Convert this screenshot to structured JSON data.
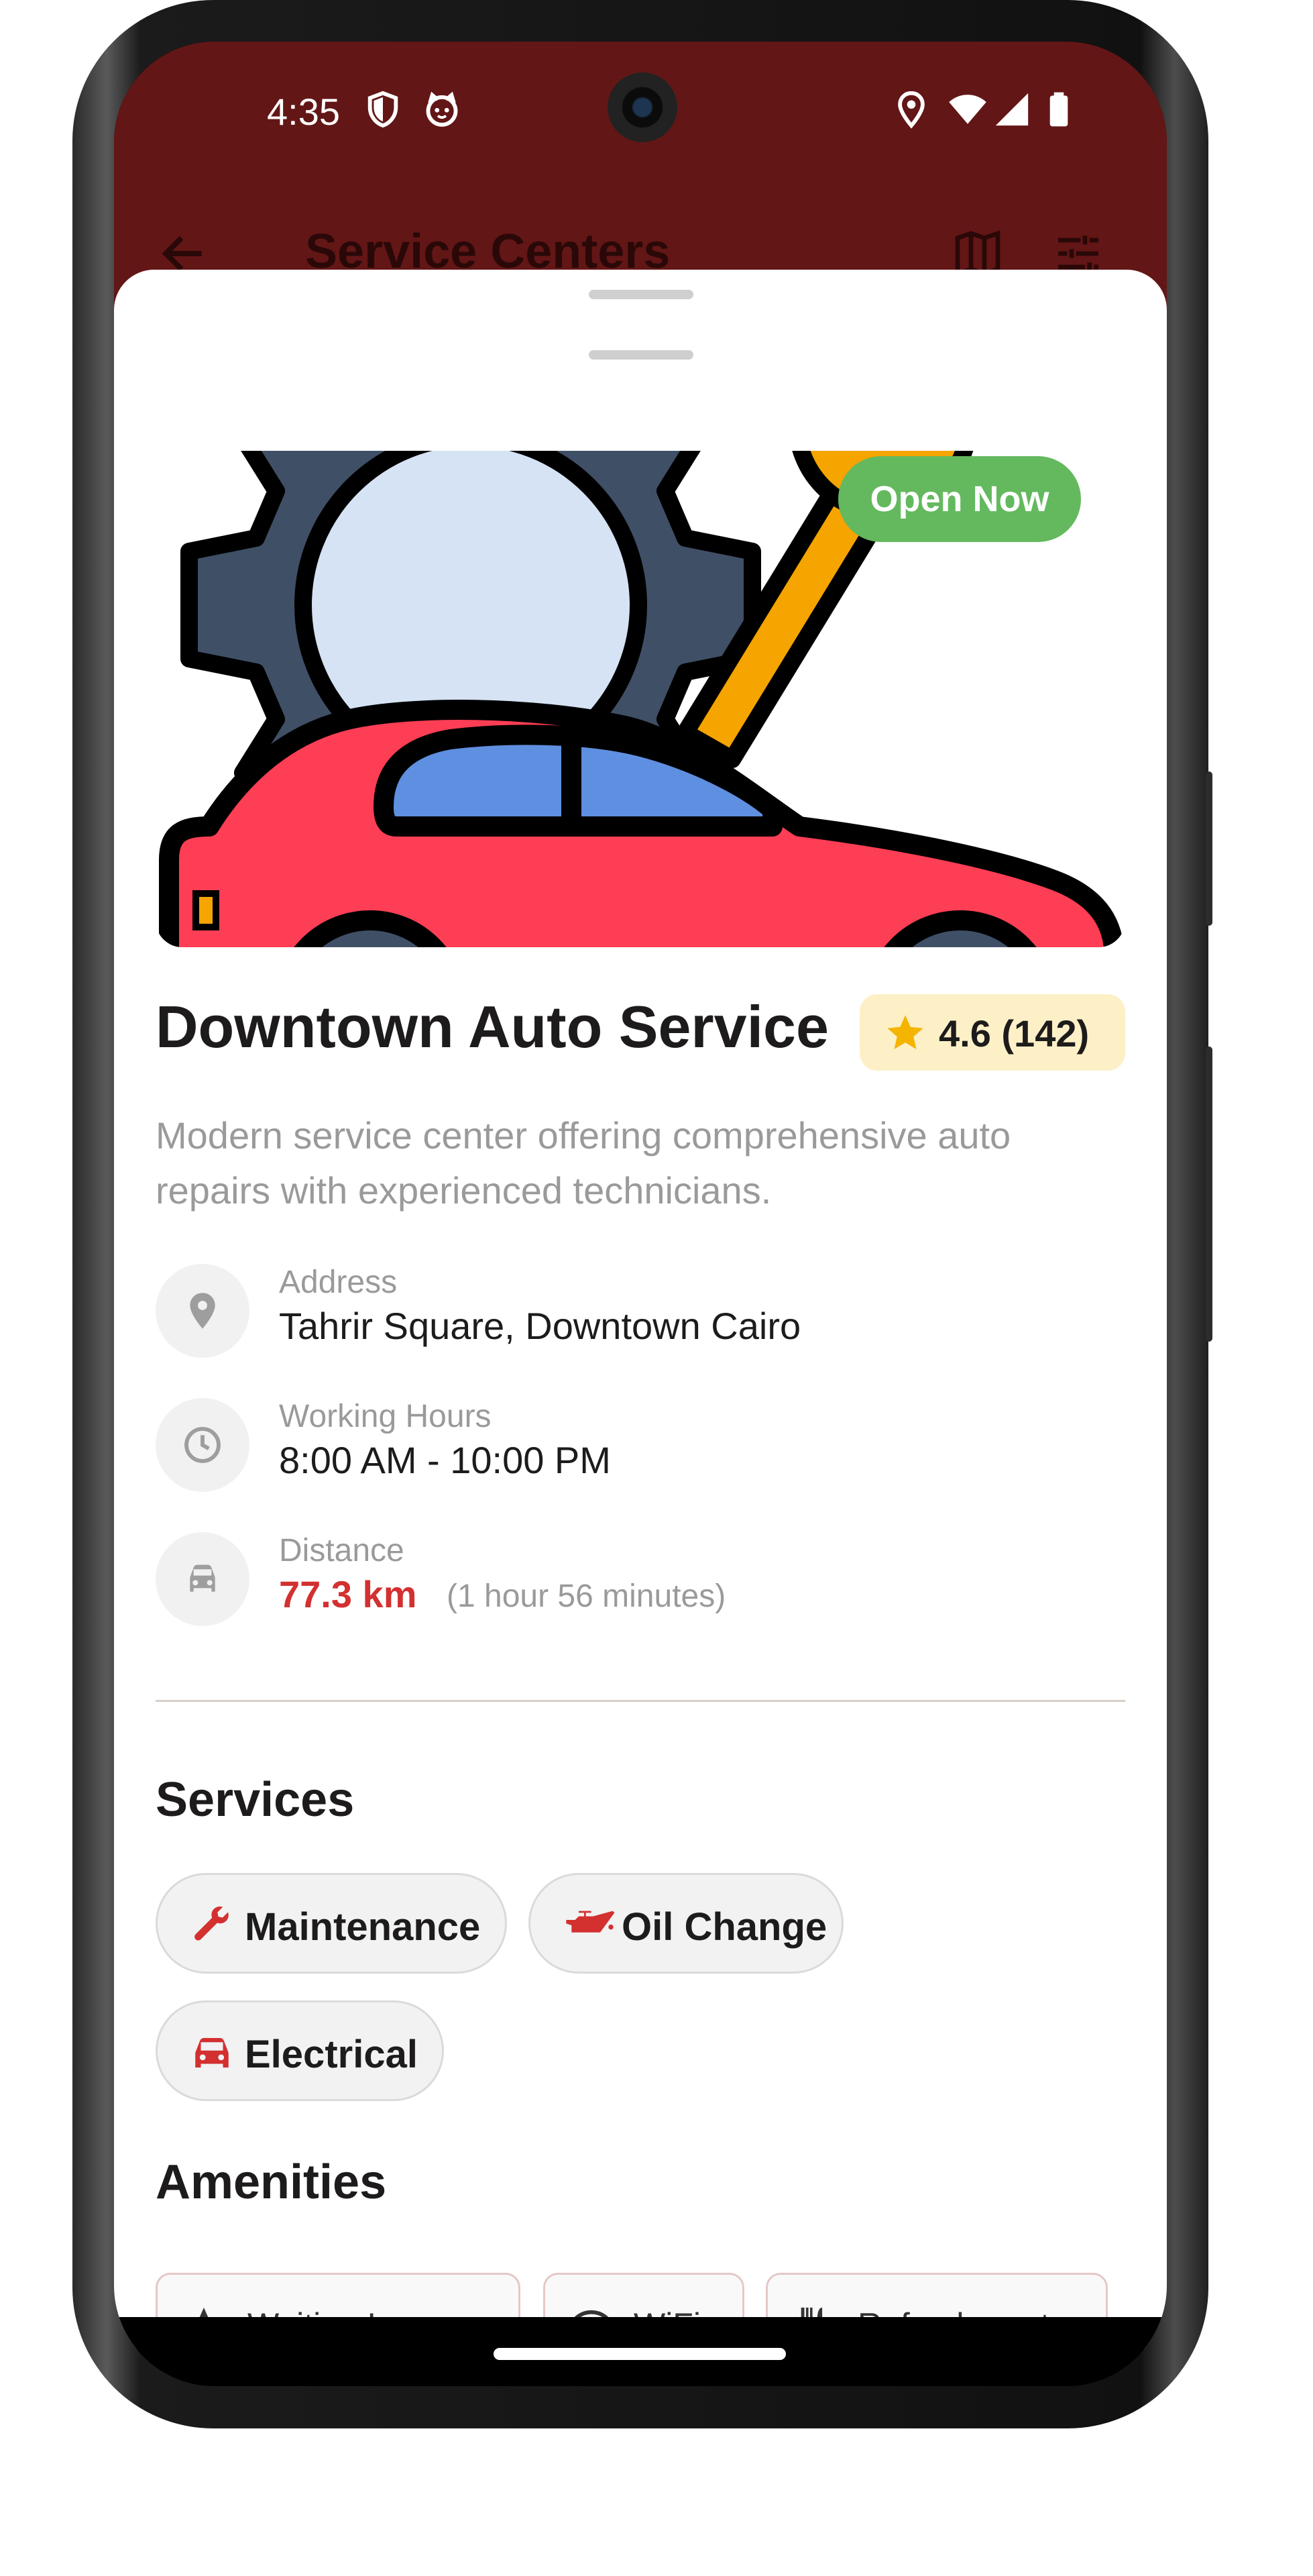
{
  "status_bar": {
    "time": "4:35",
    "left_icons": [
      "shield-icon",
      "cat-face-icon"
    ],
    "right_icons": [
      "location-icon",
      "wifi-icon",
      "signal-icon",
      "battery-icon"
    ]
  },
  "app_bar": {
    "title": "Service Centers",
    "back_icon": "arrow-back-icon",
    "actions": [
      "map-icon",
      "filter-tune-icon"
    ],
    "color": "#631616"
  },
  "detail": {
    "hero_image": "car-repair-illustration",
    "status_badge": "Open Now",
    "name": "Downtown Auto Service",
    "rating": "4.6 (142)",
    "description": "Modern service center offering comprehensive auto repairs with experienced technicians.",
    "info": {
      "address_label": "Address",
      "address_value": "Tahrir Square, Downtown Cairo",
      "hours_label": "Working Hours",
      "hours_value": "8:00 AM - 10:00 PM",
      "distance_label": "Distance",
      "distance_value": "77.3 km",
      "distance_eta": "(1 hour 56 minutes)"
    },
    "services_title": "Services",
    "services": [
      {
        "label": "Maintenance",
        "icon": "wrench-icon"
      },
      {
        "label": "Oil Change",
        "icon": "oil-can-icon"
      },
      {
        "label": "Electrical",
        "icon": "car-icon"
      }
    ],
    "amenities_title": "Amenities",
    "amenities": [
      {
        "label": "Waiting Lounge",
        "icon": "star-icon"
      },
      {
        "label": "WiFi",
        "icon": "wifi-icon"
      },
      {
        "label": "Refreshments",
        "icon": "restaurant-icon"
      }
    ]
  },
  "colors": {
    "accent_red": "#d33030",
    "open_green": "#64b95f",
    "rating_bg": "#fdf0c7",
    "star": "#f5b400"
  }
}
